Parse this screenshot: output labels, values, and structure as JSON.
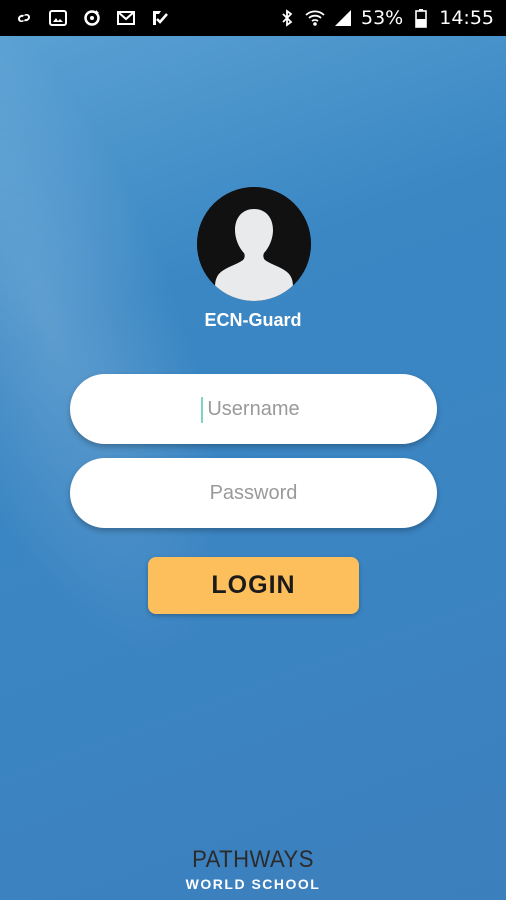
{
  "status_bar": {
    "left_icons": [
      "link-icon",
      "image-icon",
      "sync-icon",
      "gmail-icon",
      "check-badge-icon"
    ],
    "right_icons": [
      "bluetooth-icon",
      "wifi-icon",
      "signal-icon",
      "battery-icon"
    ],
    "battery": "53%",
    "time": "14:55"
  },
  "app": {
    "name": "ECN-Guard",
    "avatar_icon": "user-silhouette-icon"
  },
  "form": {
    "username_placeholder": "Username",
    "username_value": "",
    "password_placeholder": "Password",
    "password_value": "",
    "login_label": "LOGIN"
  },
  "brand": {
    "line1": "PATHWAYS",
    "line2": "WORLD SCHOOL"
  },
  "colors": {
    "background": "#3b85c3",
    "button": "#fdbf5c",
    "field": "#ffffff"
  }
}
